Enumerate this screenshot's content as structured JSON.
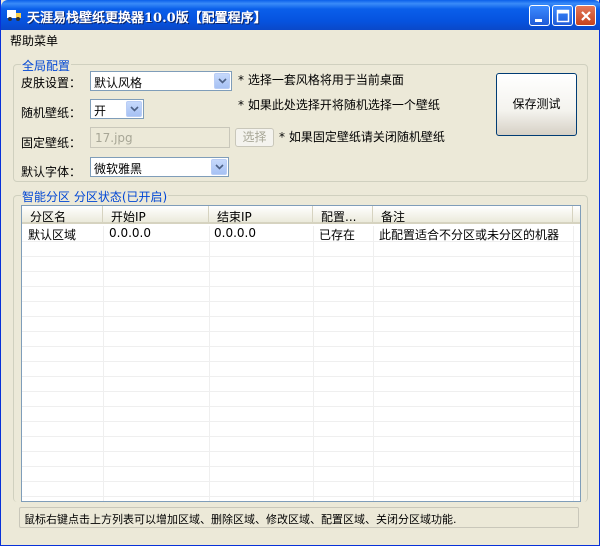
{
  "window": {
    "title": "天涯易栈壁纸更换器10.0版【配置程序】"
  },
  "menu": {
    "help": "帮助菜单"
  },
  "global_group": {
    "legend": "全局配置",
    "skin_label": "皮肤设置：",
    "skin_value": "默认风格",
    "skin_note": "* 选择一套风格将用于当前桌面",
    "random_label": "随机壁纸：",
    "random_value": "开",
    "random_note": "* 如果此处选择开将随机选择一个壁纸",
    "fixed_label": "固定壁纸：",
    "fixed_value": "17.jpg",
    "choose_button": "选择",
    "fixed_note": "* 如果固定壁纸请关闭随机壁纸",
    "font_label": "默认字体：",
    "font_value": "微软雅黑",
    "save_test_button": "保存测试"
  },
  "zone_group": {
    "legend": "智能分区 分区状态(已开启)",
    "columns": [
      "分区名",
      "开始IP",
      "结束IP",
      "配置...",
      "备注"
    ],
    "rows": [
      [
        "默认区域",
        "0.0.0.0",
        "0.0.0.0",
        "已存在",
        "此配置适合不分区或未分区的机器"
      ]
    ]
  },
  "status": {
    "text": "鼠标右键点击上方列表可以增加区域、删除区域、修改区域、配置区域、关闭分区域功能."
  }
}
